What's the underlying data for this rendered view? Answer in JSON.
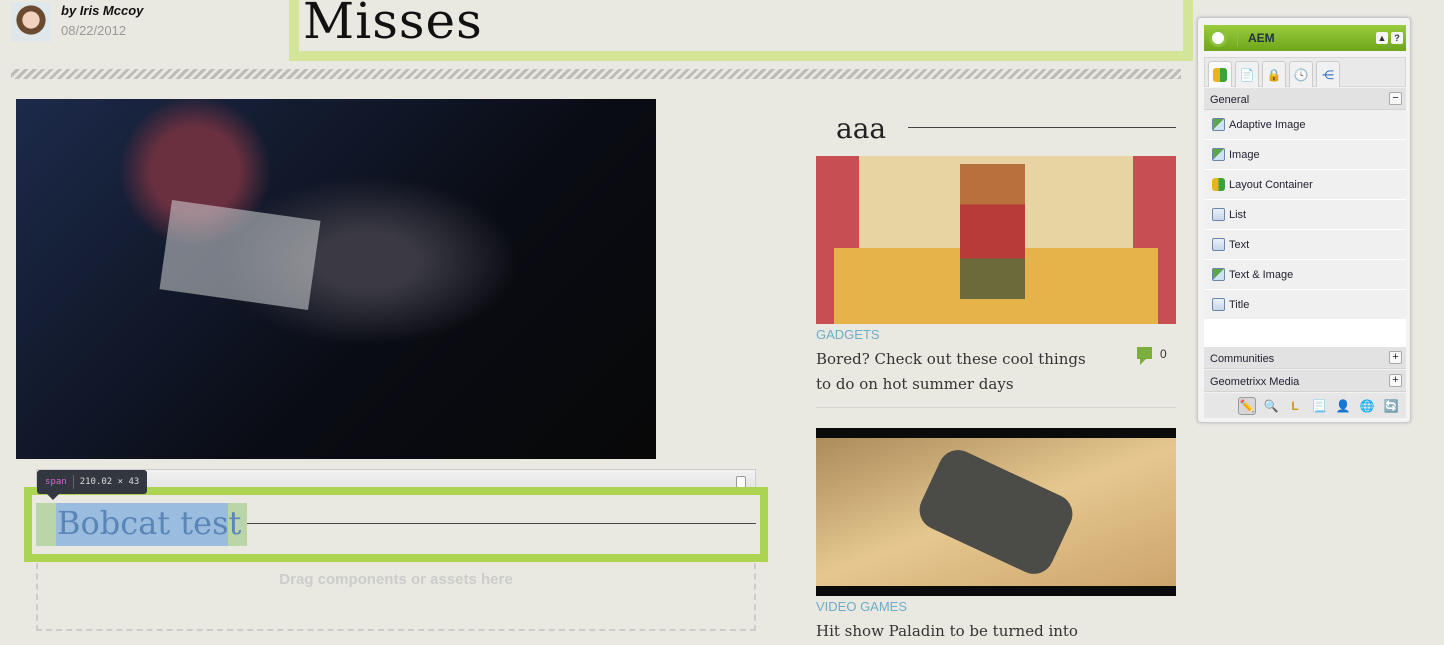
{
  "author": {
    "byline": "by Iris Mccoy",
    "date": "08/22/2012"
  },
  "page_title": "Misses",
  "editor": {
    "tooltip_tag": "span",
    "tooltip_size": "210.02 × 43",
    "title_text": "Bobcat test",
    "drop_placeholder": "Drag components or assets here"
  },
  "sidebar_title": "aaa",
  "articles": [
    {
      "category": "GADGETS",
      "headline": "Bored? Check out these cool things to do on hot summer days",
      "comments": "0"
    },
    {
      "category": "VIDEO GAMES",
      "headline": "Hit show Paladin to be turned into"
    }
  ],
  "aem": {
    "title": "AEM",
    "header_buttons": [
      "▲",
      "?"
    ],
    "tabs": [
      {
        "icon": "components-icon"
      },
      {
        "icon": "page-icon"
      },
      {
        "icon": "lock-icon"
      },
      {
        "icon": "clock-icon"
      },
      {
        "icon": "sitemap-icon"
      }
    ],
    "sections": [
      {
        "label": "General",
        "toggle": "−"
      },
      {
        "label": "Communities",
        "toggle": "+"
      },
      {
        "label": "Geometrixx Media",
        "toggle": "+"
      }
    ],
    "items": [
      {
        "label": "Adaptive Image",
        "icon": "image-icon"
      },
      {
        "label": "Image",
        "icon": "image-icon"
      },
      {
        "label": "Layout Container",
        "icon": "blocks-icon"
      },
      {
        "label": "List",
        "icon": "list-icon"
      },
      {
        "label": "Text",
        "icon": "text-icon"
      },
      {
        "label": "Text & Image",
        "icon": "text-image-icon"
      },
      {
        "label": "Title",
        "icon": "title-icon"
      }
    ],
    "footer_tools": [
      "pencil-icon",
      "magnifier-icon",
      "ruler-icon",
      "document-icon",
      "user-icon",
      "globe-icon",
      "refresh-icon"
    ]
  },
  "colors": {
    "accent_green": "#add450",
    "title_border": "#d3e697",
    "category": "#70adc7",
    "comment": "#7cae3e",
    "background": "#e9e8e1"
  }
}
